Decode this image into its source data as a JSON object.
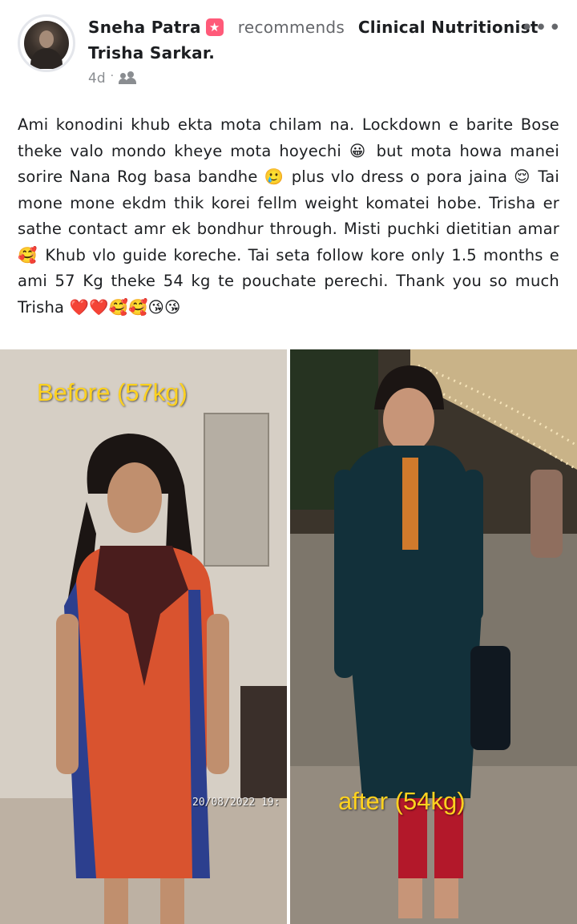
{
  "post": {
    "author": "Sneha Patra",
    "action": "recommends",
    "target_line1": "Clinical Nutritionist",
    "target_line2": "Trisha Sarkar.",
    "time": "4d",
    "body": "Ami konodini khub ekta mota chilam na. Lockdown e barite Bose theke valo mondo kheye mota hoyechi 😀 but mota howa manei sorire Nana Rog basa bandhe 🥲 plus vlo dress o pora jaina 😌 Tai mone mone ekdm thik korei fellm weight komatei hobe. Trisha er sathe contact amr ek bondhur through. Misti puchki dietitian amar 🥰 Khub vlo guide koreche. Tai seta follow kore only 1.5 months e ami 57 Kg theke 54 kg te pouchate perechi. Thank you so much Trisha ❤️❤️🥰🥰😘😘"
  },
  "photos": {
    "before_label": "Before (57kg)",
    "after_label": "after (54kg)",
    "timestamp": "20/08/2022 19:"
  },
  "icons": {
    "badge": "rising-star-badge-icon",
    "audience": "friends-audience-icon",
    "more": "more-options-icon"
  },
  "colors": {
    "caption": "#ffd21f",
    "badge": "#ff5a79",
    "muted": "#65676b"
  }
}
